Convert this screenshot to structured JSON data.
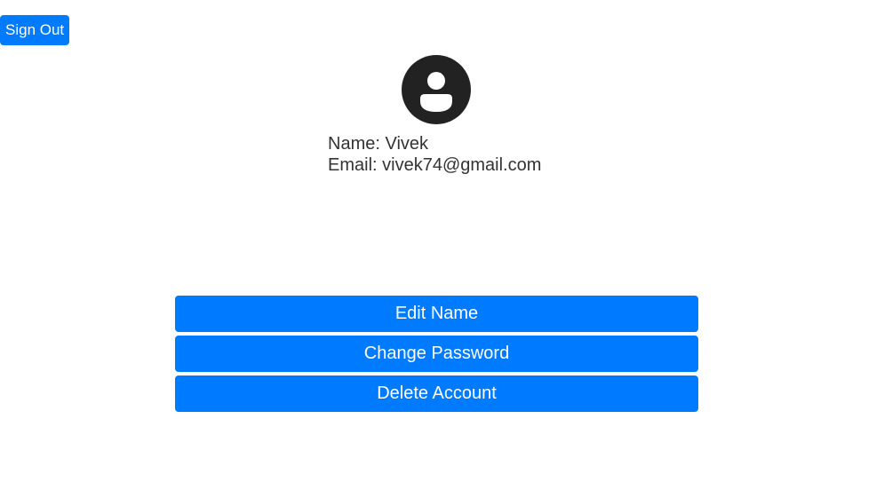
{
  "header": {
    "signout_label": "Sign Out"
  },
  "profile": {
    "avatar_icon": "account-circle-icon",
    "name_label": "Name:",
    "name_value": "Vivek",
    "email_label": "Email:",
    "email_value": "vivek74@gmail.com"
  },
  "actions": {
    "edit_name_label": "Edit Name",
    "change_password_label": "Change Password",
    "delete_account_label": "Delete Account"
  },
  "colors": {
    "accent": "#007bff",
    "avatar": "#222222",
    "text": "#333333"
  }
}
